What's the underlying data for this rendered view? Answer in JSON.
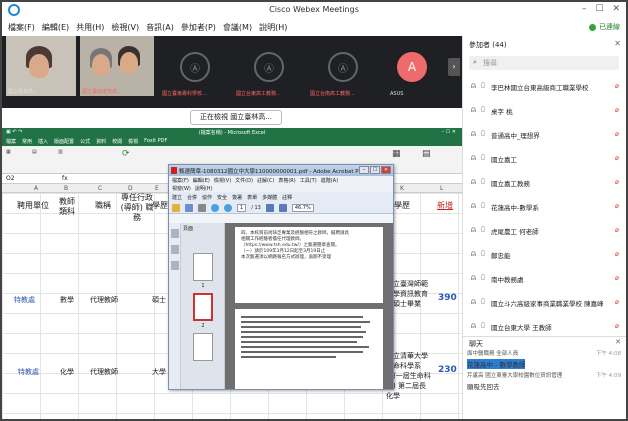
{
  "window": {
    "title": "Cisco Webex Meetings",
    "controls": [
      "–",
      "☐",
      "✕"
    ]
  },
  "menu": {
    "items": [
      "檔案(F)",
      "編輯(E)",
      "共用(H)",
      "檢視(V)",
      "音訊(A)",
      "參加者(P)",
      "會議(M)",
      "說明(H)"
    ],
    "status": "已連線"
  },
  "video_strip": {
    "tiles": [
      {
        "label": "國立臺東高...",
        "type": "camera"
      },
      {
        "label": "國立臺南家齊高...",
        "type": "camera"
      },
      {
        "label": "國立臺東專科學校...",
        "type": "avatar",
        "icon": "Ⓐ"
      },
      {
        "label": "國立台東高工教務...",
        "type": "avatar",
        "icon": "Ⓐ"
      },
      {
        "label": "國立台南高工教務...",
        "type": "avatar",
        "icon": "Ⓐ"
      },
      {
        "label": "ASUS",
        "type": "avatar",
        "icon": "A"
      }
    ]
  },
  "sharing_banner": "正在檢視 國立臺林高...",
  "excel": {
    "title": "(檔案名稱) - Microsoft Excel",
    "tabs": [
      "檔案",
      "常用",
      "插入",
      "版面配置",
      "公式",
      "資料",
      "校閱",
      "檢視",
      "Foxit PDF"
    ],
    "cell_ref": "O2",
    "fx": "fx",
    "columns": [
      "A",
      "B",
      "C",
      "D",
      "E",
      "F",
      "G",
      "H",
      "I",
      "J",
      "K",
      "L"
    ],
    "headers": [
      "聘用單位",
      "教師 類科",
      "職稱",
      "專任行政 (導師) 職務",
      "學歷"
    ],
    "headers_right": [
      "最高學歷",
      "新增"
    ],
    "rows": [
      {
        "unit": "特教處",
        "subject": "數學",
        "title": "代理教師",
        "degree": "碩士",
        "school": "國立臺灣師範大學資訊教育系碩士畢業",
        "code": "390"
      },
      {
        "unit": "特教處",
        "subject": "化學",
        "title": "代理教師",
        "degree": "大學",
        "school": "國立清華大學生命科學系 (第一屆生命科學) 第二屆長化學",
        "code": "230"
      }
    ]
  },
  "pdf": {
    "title": "甄選簡章-1080312國立中大學110000000001.pdf - Adobe Acrobat Pro",
    "menu_row1": [
      "檔案(F)",
      "編輯(E)",
      "檢視(V)",
      "文件(D)",
      "註解(C)",
      "表格(R)",
      "工具(T)",
      "進階(A)"
    ],
    "menu_row2": [
      "視窗(W)",
      "說明(H)"
    ],
    "tools_row1": [
      "建立",
      "合併",
      "協作",
      "安全",
      "簽署",
      "表單",
      "多媒體",
      "註釋"
    ],
    "page_current": "1",
    "page_total": "/ 13",
    "zoom": "46.7%",
    "sidebar_head": "頁面",
    "thumbs": [
      "1",
      "2"
    ],
    "page_text": [
      "四、本校目前尚缺乏專業及經驗相符之教師，擬聘請具",
      "相關工作經驗者擔任代理教師。",
      "（https://www.tsh.edu.tw/）之甄選簡章查閱。",
      "（一）請於109年3月12日起至3月19日止",
      "本次甄選須以網路報名方式辦理，逾期不受理"
    ]
  },
  "participants": {
    "title": "參加者 (44)",
    "search_placeholder": "搜尋",
    "items": [
      "李巴林國立台東高級商工職業學校",
      "桌字 桃",
      "普通高中_理想界",
      "國立嘉工",
      "國立嘉工教務",
      "花蓮高中-數學系",
      "虎尾農工 何老師",
      "鄭忠能",
      "南中教務處",
      "國立斗六高級家事商業職業學校 陳嘉峰",
      "國立台東大學 王教師"
    ]
  },
  "chat": {
    "title": "聊天",
    "lines": [
      {
        "text": "面中醫職務 全部人員",
        "time": "下午 4:08"
      },
      {
        "text": "花蓮高中 - 數學教師",
        "time": ""
      },
      {
        "text": "芹蘆高 國立東臺大學校園數位資訊管理",
        "time": "下午 4:09"
      },
      {
        "text": "願吸先回去",
        "time": ""
      }
    ]
  },
  "colors": {
    "excel_green": "#217346",
    "webex_dark": "#1f2024",
    "mute_red": "#e0322f",
    "accent_blue": "#2d7dd2"
  }
}
